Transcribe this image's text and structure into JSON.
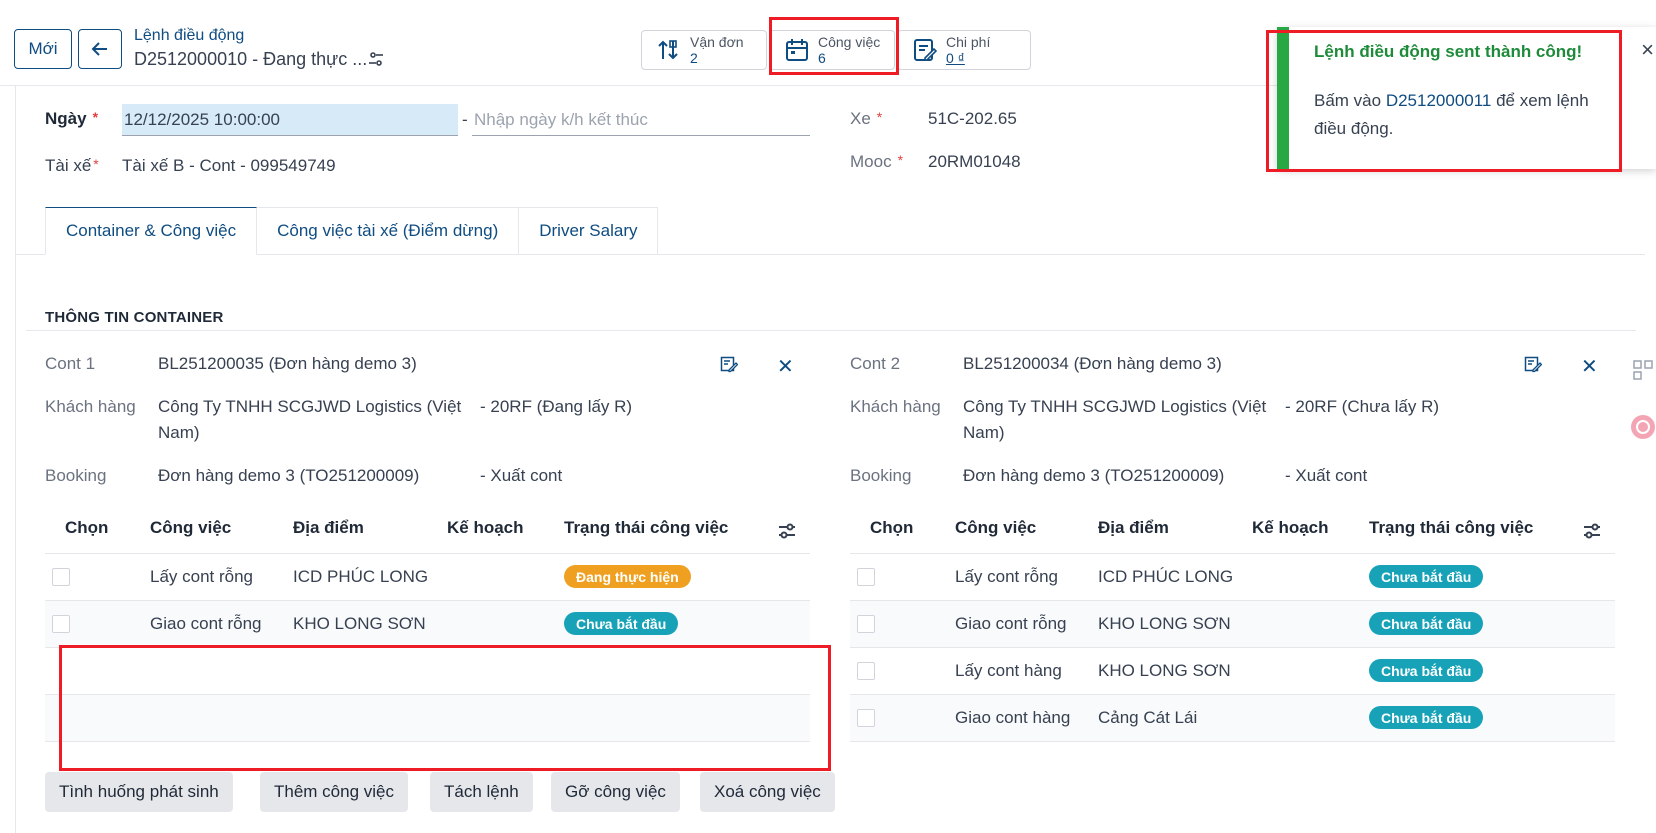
{
  "header": {
    "new_button": "Mới",
    "breadcrumb_parent": "Lệnh điều động",
    "breadcrumb_current": "D2512000010 - Đang thực ..."
  },
  "smart_buttons": {
    "van_don": {
      "label": "Vận đơn",
      "value": "2"
    },
    "cong_viec": {
      "label": "Công việc",
      "value": "6"
    },
    "chi_phi": {
      "label": "Chi phí",
      "value": "0 ₫"
    }
  },
  "toast": {
    "title": "Lệnh điều động sent thành công!",
    "body_prefix": "Bấm vào ",
    "body_link": "D2512000011",
    "body_suffix": " để xem lệnh điều động.",
    "close": "×"
  },
  "form": {
    "ngay_label": "Ngày",
    "ngay_value": "12/12/2025 10:00:00",
    "ngay_sep": "-",
    "ngay_end_placeholder": "Nhập ngày k/h kết thúc",
    "tai_xe_label": "Tài xế",
    "tai_xe_value": "Tài xế B - Cont - 099549749",
    "xe_label": "Xe",
    "xe_value": "51C-202.65",
    "mooc_label": "Mooc",
    "mooc_value": "20RM01048",
    "required_mark": "*"
  },
  "tabs": [
    {
      "label": "Container & Công việc"
    },
    {
      "label": "Công việc tài xế (Điểm dừng)"
    },
    {
      "label": "Driver Salary"
    }
  ],
  "section_title": "THÔNG TIN CONTAINER",
  "containers": [
    {
      "cont_label": "Cont 1",
      "cont_value": "BL251200035 (Đơn hàng demo 3)",
      "kh_label": "Khách hàng",
      "kh_value_1": "Công Ty TNHH SCGJWD Logistics (Việt",
      "kh_value_2": "Nam)",
      "kh_extra": "- 20RF (Đang lấy R)",
      "booking_label": "Booking",
      "booking_value": "Đơn hàng demo 3 (TO251200009)",
      "booking_extra": "- Xuất cont",
      "headers": [
        "Chọn",
        "Công việc",
        "Địa điểm",
        "Kế hoạch",
        "Trạng thái công việc"
      ],
      "rows": [
        {
          "job": "Lấy cont rỗng",
          "place": "ICD PHÚC LONG",
          "status": "Đang thực hiện",
          "color": "#f0a020"
        },
        {
          "job": "Giao cont rỗng",
          "place": "KHO LONG SƠN",
          "status": "Chưa bắt đầu",
          "color": "#17a2b8"
        }
      ]
    },
    {
      "cont_label": "Cont 2",
      "cont_value": "BL251200034 (Đơn hàng demo 3)",
      "kh_label": "Khách hàng",
      "kh_value_1": "Công Ty TNHH SCGJWD Logistics (Việt",
      "kh_value_2": "Nam)",
      "kh_extra": "- 20RF (Chưa lấy R)",
      "booking_label": "Booking",
      "booking_value": "Đơn hàng demo 3 (TO251200009)",
      "booking_extra": "- Xuất cont",
      "headers": [
        "Chọn",
        "Công việc",
        "Địa điểm",
        "Kế hoạch",
        "Trạng thái công việc"
      ],
      "rows": [
        {
          "job": "Lấy cont rỗng",
          "place": "ICD PHÚC LONG",
          "status": "Chưa bắt đầu",
          "color": "#17a2b8"
        },
        {
          "job": "Giao cont rỗng",
          "place": "KHO LONG SƠN",
          "status": "Chưa bắt đầu",
          "color": "#17a2b8"
        },
        {
          "job": "Lấy cont hàng",
          "place": "KHO LONG SƠN",
          "status": "Chưa bắt đầu",
          "color": "#17a2b8"
        },
        {
          "job": "Giao cont hàng",
          "place": "Cảng Cát Lái",
          "status": "Chưa bắt đầu",
          "color": "#17a2b8"
        }
      ]
    }
  ],
  "actions": {
    "tinh_huong": "Tình huống phát sinh",
    "them": "Thêm công việc",
    "tach": "Tách lệnh",
    "go": "Gỡ công việc",
    "xoa": "Xoá công việc"
  },
  "colors": {
    "primary": "#0f4c81",
    "success": "#28a745",
    "highlight": "#ee1c24",
    "badge_in_progress": "#f0a020",
    "badge_not_started": "#17a2b8"
  }
}
